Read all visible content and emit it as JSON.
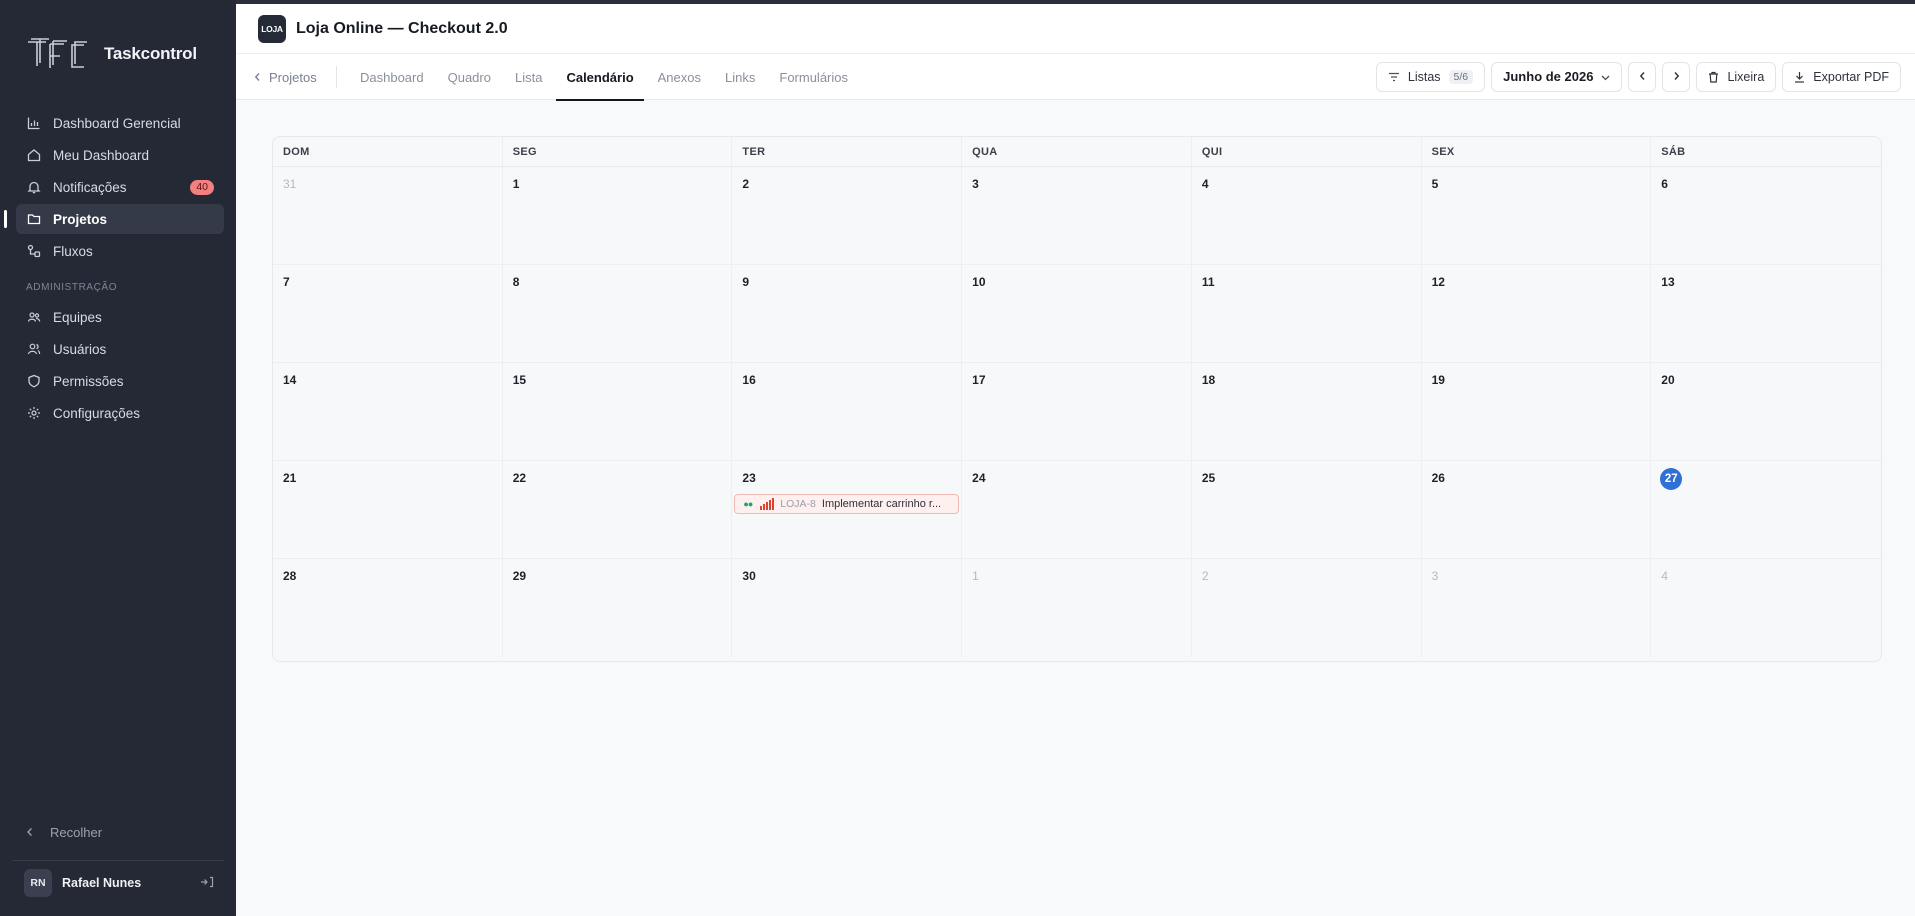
{
  "brand": {
    "name": "Taskcontrol",
    "logo_icon": "tfc-logo-icon"
  },
  "sidebar": {
    "items": [
      {
        "label": "Dashboard Gerencial",
        "icon": "bar-chart-icon",
        "active": false
      },
      {
        "label": "Meu Dashboard",
        "icon": "home-icon",
        "active": false
      },
      {
        "label": "Notificações",
        "icon": "bell-icon",
        "active": false,
        "badge": "40"
      },
      {
        "label": "Projetos",
        "icon": "folder-icon",
        "active": true
      },
      {
        "label": "Fluxos",
        "icon": "workflow-icon",
        "active": false
      }
    ],
    "admin_section": "ADMINISTRAÇÃO",
    "admin_items": [
      {
        "label": "Equipes",
        "icon": "team-icon"
      },
      {
        "label": "Usuários",
        "icon": "users-icon"
      },
      {
        "label": "Permissões",
        "icon": "shield-icon"
      },
      {
        "label": "Configurações",
        "icon": "gear-icon"
      }
    ],
    "collapse_label": "Recolher",
    "user": {
      "initials": "RN",
      "name": "Rafael Nunes",
      "logout_icon": "logout-icon"
    }
  },
  "header": {
    "project_logo": "LOJA",
    "project_title": "Loja Online — Checkout 2.0"
  },
  "tabbar": {
    "back_label": "Projetos",
    "tabs": [
      "Dashboard",
      "Quadro",
      "Lista",
      "Calendário",
      "Anexos",
      "Links",
      "Formulários"
    ],
    "active_tab": "Calendário",
    "lists_label": "Listas",
    "lists_count": "5/6",
    "month_label": "Junho de 2026",
    "trash_label": "Lixeira",
    "export_label": "Exportar PDF"
  },
  "calendar": {
    "weekdays": [
      "DOM",
      "SEG",
      "TER",
      "QUA",
      "QUI",
      "SEX",
      "SÁB"
    ],
    "today": "27",
    "days": [
      {
        "d": "31",
        "muted": true
      },
      {
        "d": "1"
      },
      {
        "d": "2"
      },
      {
        "d": "3"
      },
      {
        "d": "4"
      },
      {
        "d": "5"
      },
      {
        "d": "6"
      },
      {
        "d": "7"
      },
      {
        "d": "8"
      },
      {
        "d": "9"
      },
      {
        "d": "10"
      },
      {
        "d": "11"
      },
      {
        "d": "12"
      },
      {
        "d": "13"
      },
      {
        "d": "14"
      },
      {
        "d": "15"
      },
      {
        "d": "16"
      },
      {
        "d": "17"
      },
      {
        "d": "18"
      },
      {
        "d": "19"
      },
      {
        "d": "20"
      },
      {
        "d": "21"
      },
      {
        "d": "22"
      },
      {
        "d": "23"
      },
      {
        "d": "24"
      },
      {
        "d": "25"
      },
      {
        "d": "26"
      },
      {
        "d": "27",
        "today": true
      },
      {
        "d": "28"
      },
      {
        "d": "29"
      },
      {
        "d": "30"
      },
      {
        "d": "1",
        "muted": true
      },
      {
        "d": "2",
        "muted": true
      },
      {
        "d": "3",
        "muted": true
      },
      {
        "d": "4",
        "muted": true
      }
    ],
    "events": [
      {
        "day_index": 23,
        "key": "LOJA-8",
        "title": "Implementar carrinho r...",
        "priority_icon": "priority-bars-icon",
        "status_color": "#22a36a",
        "priority_color": "#d9432f"
      }
    ]
  }
}
